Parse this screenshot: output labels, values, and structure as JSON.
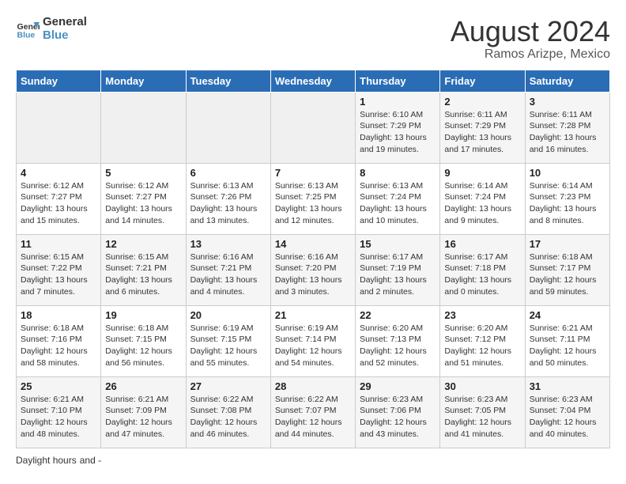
{
  "header": {
    "logo_line1": "General",
    "logo_line2": "Blue",
    "main_title": "August 2024",
    "subtitle": "Ramos Arizpe, Mexico"
  },
  "days_of_week": [
    "Sunday",
    "Monday",
    "Tuesday",
    "Wednesday",
    "Thursday",
    "Friday",
    "Saturday"
  ],
  "weeks": [
    [
      {
        "day": "",
        "info": ""
      },
      {
        "day": "",
        "info": ""
      },
      {
        "day": "",
        "info": ""
      },
      {
        "day": "",
        "info": ""
      },
      {
        "day": "1",
        "info": "Sunrise: 6:10 AM\nSunset: 7:29 PM\nDaylight: 13 hours\nand 19 minutes."
      },
      {
        "day": "2",
        "info": "Sunrise: 6:11 AM\nSunset: 7:29 PM\nDaylight: 13 hours\nand 17 minutes."
      },
      {
        "day": "3",
        "info": "Sunrise: 6:11 AM\nSunset: 7:28 PM\nDaylight: 13 hours\nand 16 minutes."
      }
    ],
    [
      {
        "day": "4",
        "info": "Sunrise: 6:12 AM\nSunset: 7:27 PM\nDaylight: 13 hours\nand 15 minutes."
      },
      {
        "day": "5",
        "info": "Sunrise: 6:12 AM\nSunset: 7:27 PM\nDaylight: 13 hours\nand 14 minutes."
      },
      {
        "day": "6",
        "info": "Sunrise: 6:13 AM\nSunset: 7:26 PM\nDaylight: 13 hours\nand 13 minutes."
      },
      {
        "day": "7",
        "info": "Sunrise: 6:13 AM\nSunset: 7:25 PM\nDaylight: 13 hours\nand 12 minutes."
      },
      {
        "day": "8",
        "info": "Sunrise: 6:13 AM\nSunset: 7:24 PM\nDaylight: 13 hours\nand 10 minutes."
      },
      {
        "day": "9",
        "info": "Sunrise: 6:14 AM\nSunset: 7:24 PM\nDaylight: 13 hours\nand 9 minutes."
      },
      {
        "day": "10",
        "info": "Sunrise: 6:14 AM\nSunset: 7:23 PM\nDaylight: 13 hours\nand 8 minutes."
      }
    ],
    [
      {
        "day": "11",
        "info": "Sunrise: 6:15 AM\nSunset: 7:22 PM\nDaylight: 13 hours\nand 7 minutes."
      },
      {
        "day": "12",
        "info": "Sunrise: 6:15 AM\nSunset: 7:21 PM\nDaylight: 13 hours\nand 6 minutes."
      },
      {
        "day": "13",
        "info": "Sunrise: 6:16 AM\nSunset: 7:21 PM\nDaylight: 13 hours\nand 4 minutes."
      },
      {
        "day": "14",
        "info": "Sunrise: 6:16 AM\nSunset: 7:20 PM\nDaylight: 13 hours\nand 3 minutes."
      },
      {
        "day": "15",
        "info": "Sunrise: 6:17 AM\nSunset: 7:19 PM\nDaylight: 13 hours\nand 2 minutes."
      },
      {
        "day": "16",
        "info": "Sunrise: 6:17 AM\nSunset: 7:18 PM\nDaylight: 13 hours\nand 0 minutes."
      },
      {
        "day": "17",
        "info": "Sunrise: 6:18 AM\nSunset: 7:17 PM\nDaylight: 12 hours\nand 59 minutes."
      }
    ],
    [
      {
        "day": "18",
        "info": "Sunrise: 6:18 AM\nSunset: 7:16 PM\nDaylight: 12 hours\nand 58 minutes."
      },
      {
        "day": "19",
        "info": "Sunrise: 6:18 AM\nSunset: 7:15 PM\nDaylight: 12 hours\nand 56 minutes."
      },
      {
        "day": "20",
        "info": "Sunrise: 6:19 AM\nSunset: 7:15 PM\nDaylight: 12 hours\nand 55 minutes."
      },
      {
        "day": "21",
        "info": "Sunrise: 6:19 AM\nSunset: 7:14 PM\nDaylight: 12 hours\nand 54 minutes."
      },
      {
        "day": "22",
        "info": "Sunrise: 6:20 AM\nSunset: 7:13 PM\nDaylight: 12 hours\nand 52 minutes."
      },
      {
        "day": "23",
        "info": "Sunrise: 6:20 AM\nSunset: 7:12 PM\nDaylight: 12 hours\nand 51 minutes."
      },
      {
        "day": "24",
        "info": "Sunrise: 6:21 AM\nSunset: 7:11 PM\nDaylight: 12 hours\nand 50 minutes."
      }
    ],
    [
      {
        "day": "25",
        "info": "Sunrise: 6:21 AM\nSunset: 7:10 PM\nDaylight: 12 hours\nand 48 minutes."
      },
      {
        "day": "26",
        "info": "Sunrise: 6:21 AM\nSunset: 7:09 PM\nDaylight: 12 hours\nand 47 minutes."
      },
      {
        "day": "27",
        "info": "Sunrise: 6:22 AM\nSunset: 7:08 PM\nDaylight: 12 hours\nand 46 minutes."
      },
      {
        "day": "28",
        "info": "Sunrise: 6:22 AM\nSunset: 7:07 PM\nDaylight: 12 hours\nand 44 minutes."
      },
      {
        "day": "29",
        "info": "Sunrise: 6:23 AM\nSunset: 7:06 PM\nDaylight: 12 hours\nand 43 minutes."
      },
      {
        "day": "30",
        "info": "Sunrise: 6:23 AM\nSunset: 7:05 PM\nDaylight: 12 hours\nand 41 minutes."
      },
      {
        "day": "31",
        "info": "Sunrise: 6:23 AM\nSunset: 7:04 PM\nDaylight: 12 hours\nand 40 minutes."
      }
    ]
  ],
  "footer": {
    "daylight_label": "Daylight hours",
    "and_dash": "and -"
  }
}
